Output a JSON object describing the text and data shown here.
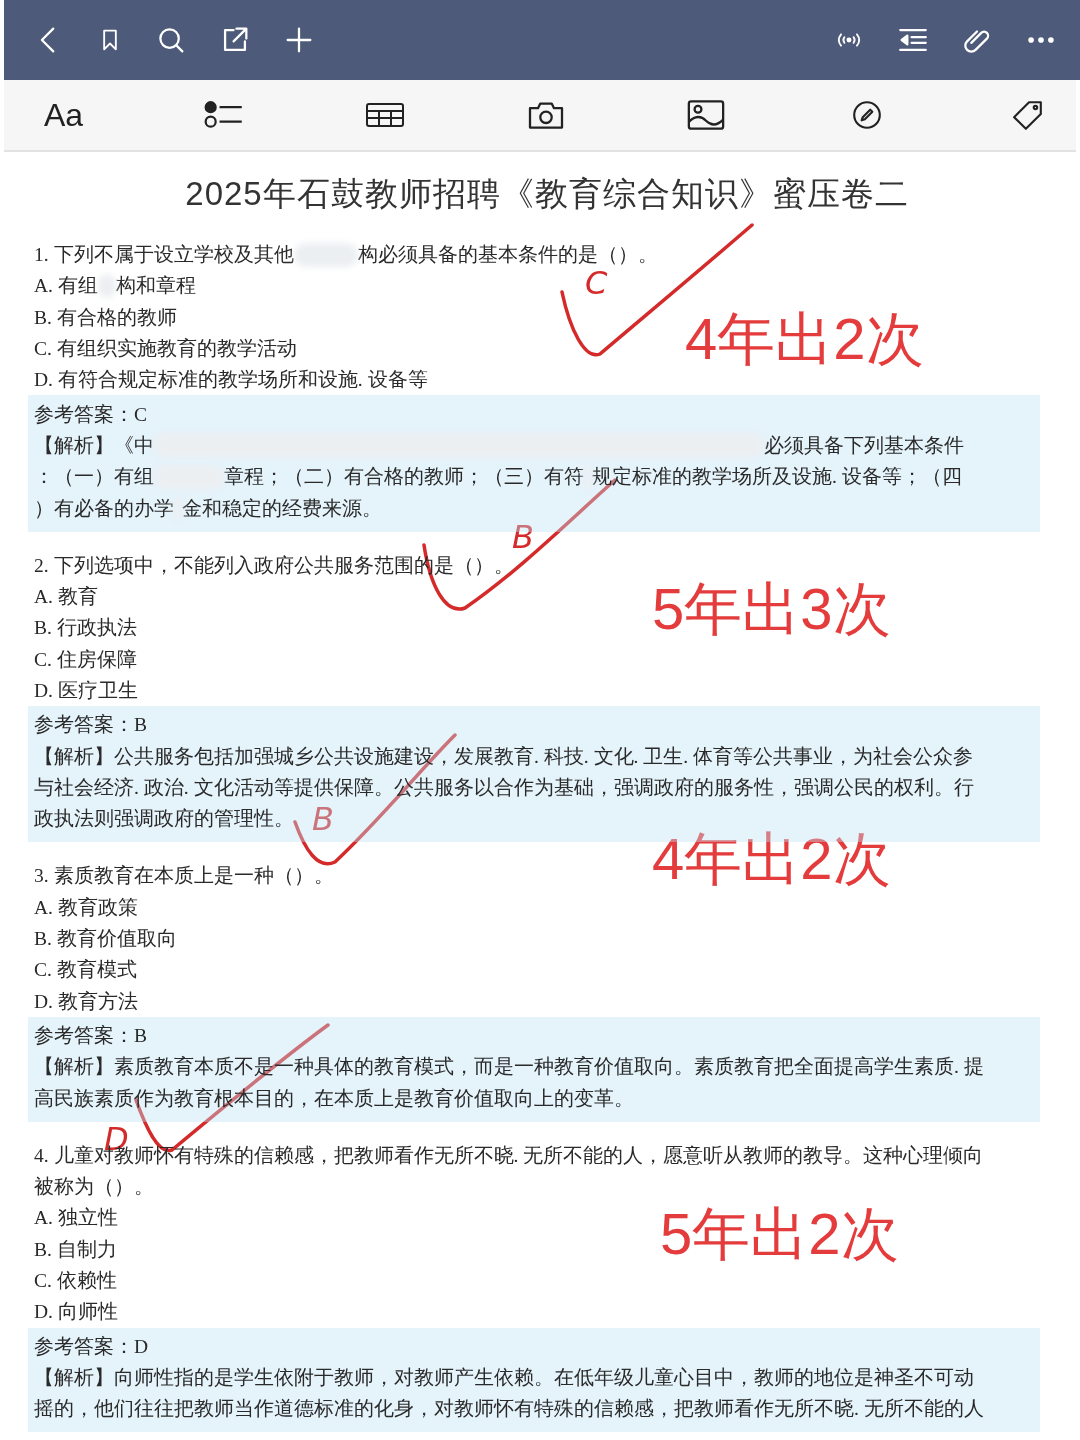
{
  "toolbar": {
    "format_label": "Aa"
  },
  "document": {
    "title": "2025年石鼓教师招聘《教育综合知识》蜜压卷二",
    "questions": [
      {
        "stem": [
          [
            "1. 下列不属于设立学校及其他",
            "构必须具备的基本条件的是（）。"
          ]
        ],
        "options": [
          [
            "A. 有组",
            "构和章程"
          ],
          [
            "B. 有合格的教师"
          ],
          [
            "C. 有组织实施教育的教学活动"
          ],
          [
            "D. 有符合规定标准的教学场所和设施. 设备等"
          ]
        ],
        "answer": "参考答案：C",
        "explanation": [
          [
            "【解析】《中",
            "必须具备下列基本条件"
          ],
          [
            "：（一）有组",
            "章程；（二）有合格的教师；（三）有符",
            "规定标准的教学场所及设施. 设备等；（四"
          ],
          [
            "）有必备的办学",
            "金和稳定的经费来源。"
          ]
        ]
      },
      {
        "stem": [
          [
            "2. 下列选项中，不能列入政府公共服务范围的是（）。"
          ]
        ],
        "options": [
          [
            "A. 教育"
          ],
          [
            "B. 行政执法"
          ],
          [
            "C. 住房保障"
          ],
          [
            "D. 医疗卫生"
          ]
        ],
        "answer": "参考答案：B",
        "explanation": [
          [
            "【解析】公共服务包括加强城乡公共设施建设，发展教育. 科技. 文化. 卫生. 体育等公共事业，为社会公众参"
          ],
          [
            "与社会经济. 政治. 文化活动等提供保障。公共服务以合作为基础，强调政府的服务性，强调公民的权利。行"
          ],
          [
            "政执法则强调政府的管理性。"
          ]
        ]
      },
      {
        "stem": [
          [
            "3. 素质教育在本质上是一种（）。"
          ]
        ],
        "options": [
          [
            "A. 教育政策"
          ],
          [
            "B. 教育价值取向"
          ],
          [
            "C. 教育模式"
          ],
          [
            "D. 教育方法"
          ]
        ],
        "answer": "参考答案：B",
        "explanation": [
          [
            "【解析】素质教育本质不是一种具体的教育模式，而是一种教育价值取向。素质教育把全面提高学生素质. 提"
          ],
          [
            "高民族素质作为教育根本目的，在本质上是教育价值取向上的变革。"
          ]
        ]
      },
      {
        "stem": [
          [
            "4. 儿童对教师怀有特殊的信赖感，把教师看作无所不晓. 无所不能的人，愿意听从教师的教导。这种心理倾向"
          ],
          [
            "被称为（）。"
          ]
        ],
        "options": [
          [
            "A. 独立性"
          ],
          [
            "B. 自制力"
          ],
          [
            "C. 依赖性"
          ],
          [
            "D. 向师性"
          ]
        ],
        "answer": "参考答案：D",
        "explanation": [
          [
            "【解析】向师性指的是学生依附于教师，对教师产生依赖。在低年级儿童心目中，教师的地位是神圣不可动"
          ],
          [
            "摇的，他们往往把教师当作道德标准的化身，对教师怀有特殊的信赖感，把教师看作无所不晓. 无所不能的人"
          ]
        ]
      }
    ]
  },
  "annotations": [
    {
      "letter": "C",
      "note": "4年出2次"
    },
    {
      "letter": "B",
      "note": "5年出3次"
    },
    {
      "letter": "B",
      "note": "4年出2次"
    },
    {
      "letter": "D",
      "note": "5年出2次"
    }
  ]
}
